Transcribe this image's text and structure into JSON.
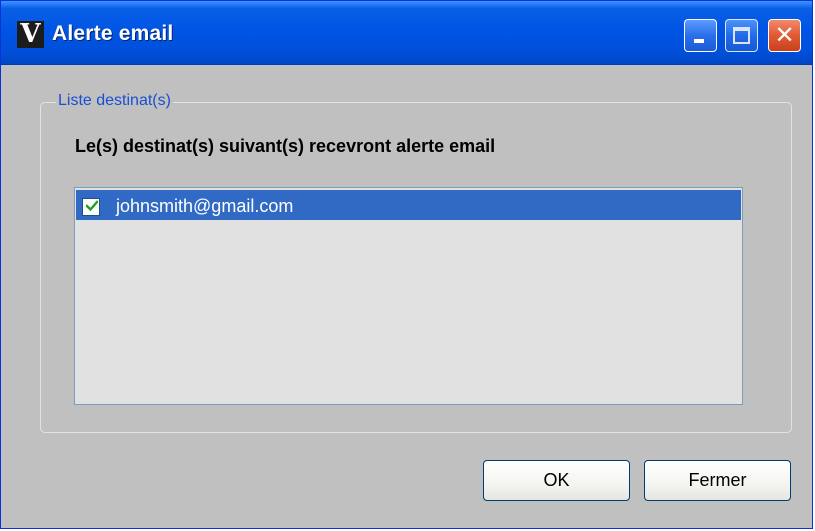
{
  "window": {
    "title": "Alerte email",
    "app_icon_glyph": "V",
    "controls": {
      "minimize_icon": "minimize-icon",
      "maximize_icon": "maximize-icon",
      "close_icon": "close-icon",
      "close_glyph": "✕"
    },
    "colors": {
      "titlebar": "#0055e5",
      "background": "#c0c0c0",
      "selection": "#316ac5",
      "legend_text": "#1a4fd4"
    }
  },
  "group": {
    "legend": "Liste destinat(s)",
    "instruction": "Le(s) destinat(s) suivant(s) recevront alerte email"
  },
  "recipients": [
    {
      "email": "johnsmith@gmail.com",
      "checked": true,
      "selected": true
    }
  ],
  "buttons": {
    "ok_label": "OK",
    "close_label": "Fermer"
  }
}
